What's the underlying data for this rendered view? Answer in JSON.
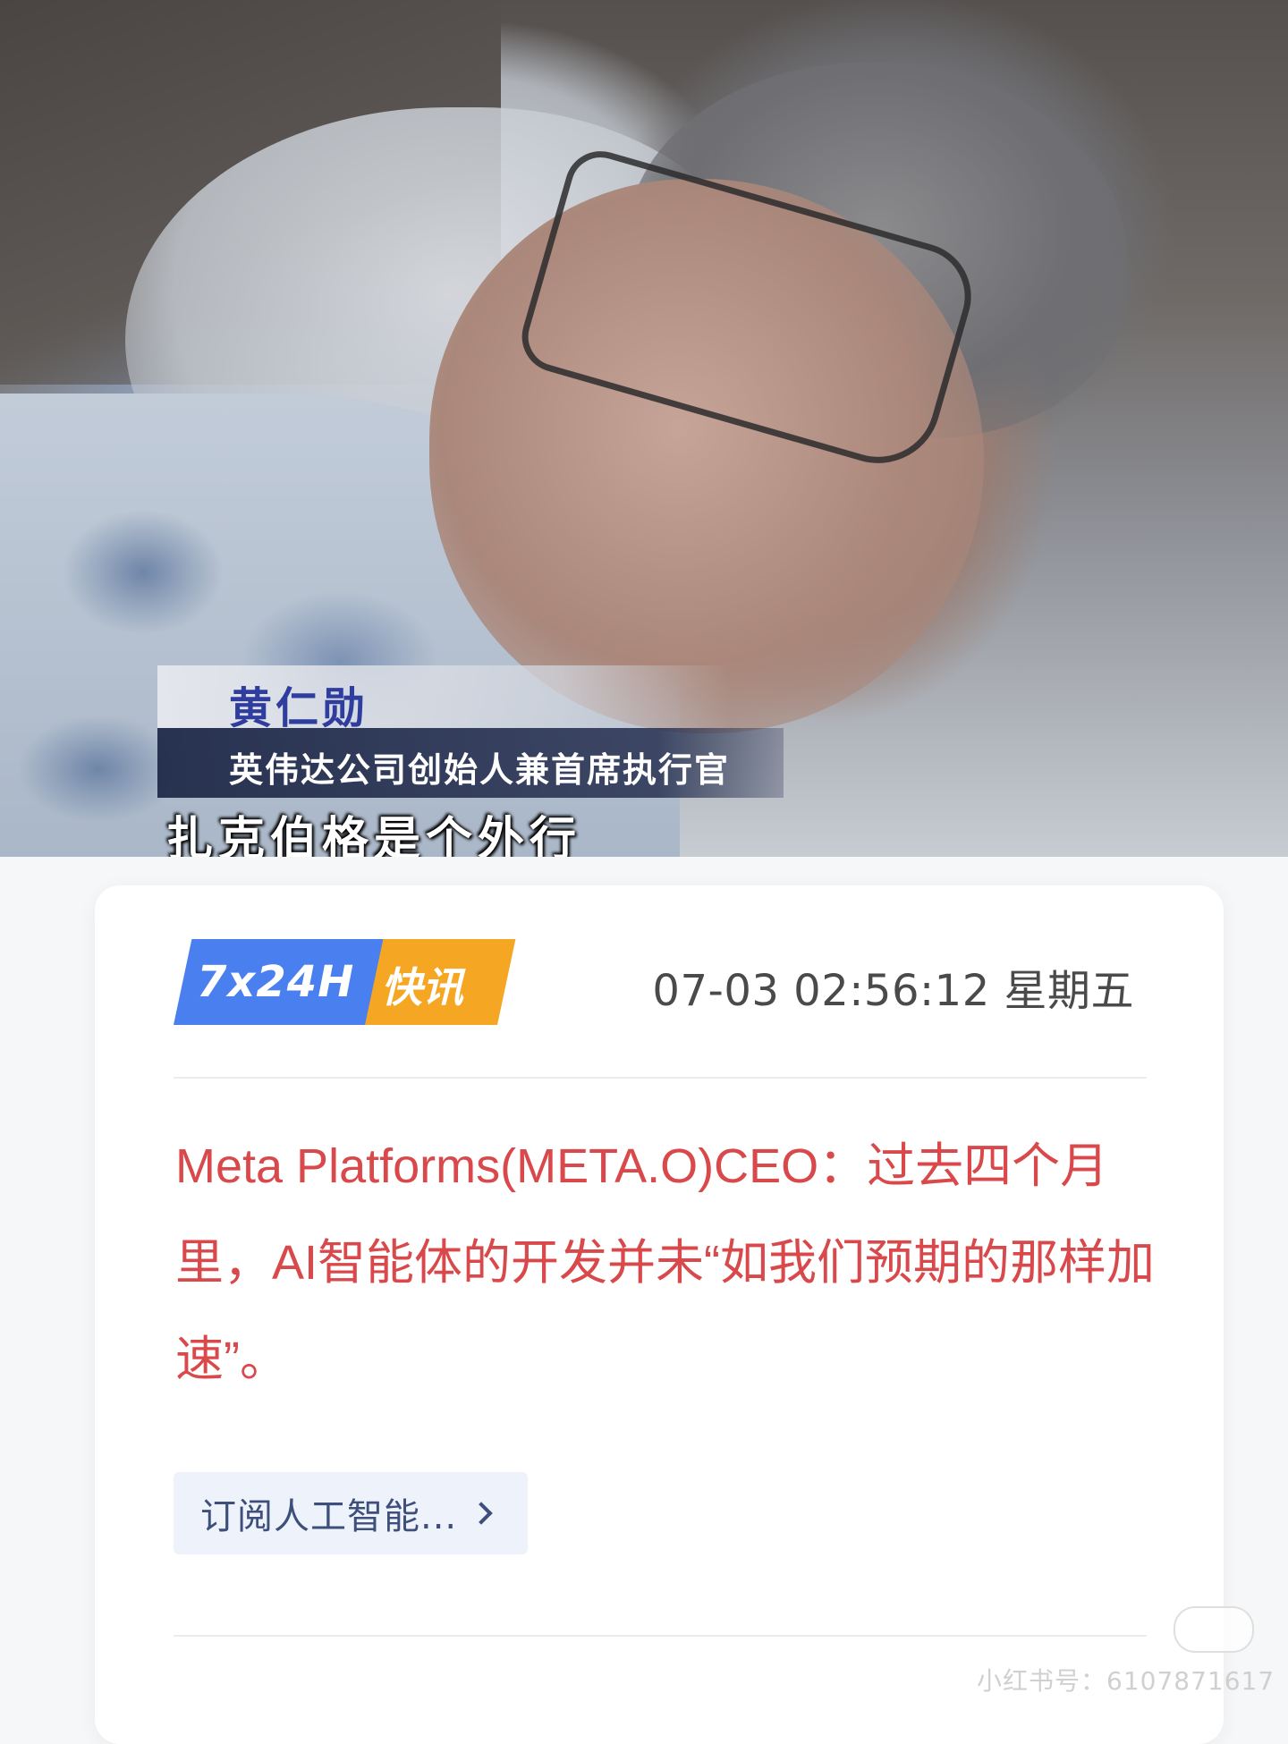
{
  "video": {
    "name_caption": "黄仁勋",
    "title_caption": "英伟达公司创始人兼首席执行官",
    "subtitle": "扎克伯格是个外行"
  },
  "news": {
    "badge_primary": "7x24H",
    "badge_secondary": "快讯",
    "datetime": "07-03 02:56:12 星期五",
    "headline": "Meta Platforms(META.O)CEO：过去四个月里，AI智能体的开发并未“如我们预期的那样加速”。",
    "subscribe_label": "订阅人工智能...",
    "subscribe_icon": "chevron-right-icon",
    "colors": {
      "headline": "#d9484a",
      "badge_blue": "#4a7ff0",
      "badge_orange": "#f5a623"
    }
  },
  "watermark": {
    "logo_text": "小红书",
    "account_id": "小红书号：6107871617"
  }
}
